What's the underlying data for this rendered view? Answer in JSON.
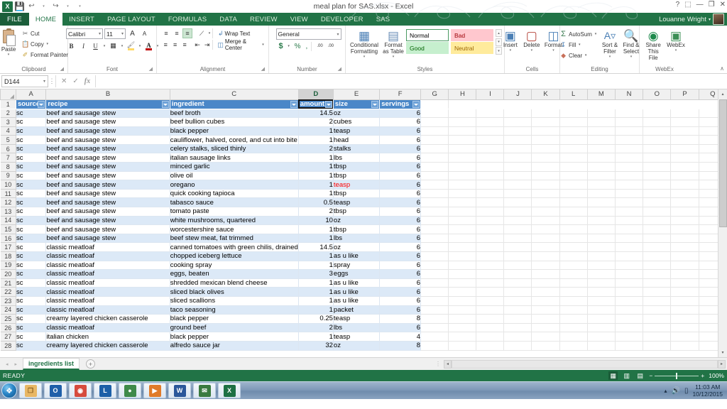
{
  "window": {
    "title": "meal plan for SAS.xlsx - Excel",
    "help_label": "?",
    "ribbon_display_label": "⬚",
    "minimize_label": "—",
    "restore_label": "❐",
    "close_label": "✕"
  },
  "quick_access": {
    "app_logo": "X",
    "items": [
      {
        "name": "save-icon",
        "glyph": "💾"
      },
      {
        "name": "undo-icon",
        "glyph": "↩"
      },
      {
        "name": "redo-icon",
        "glyph": "↪"
      },
      {
        "name": "customize-qat-icon",
        "glyph": "▾"
      }
    ]
  },
  "ribbon_tabs": {
    "file": "FILE",
    "items": [
      {
        "label": "HOME",
        "active": true
      },
      {
        "label": "INSERT",
        "active": false
      },
      {
        "label": "PAGE LAYOUT",
        "active": false
      },
      {
        "label": "FORMULAS",
        "active": false
      },
      {
        "label": "DATA",
        "active": false
      },
      {
        "label": "REVIEW",
        "active": false
      },
      {
        "label": "VIEW",
        "active": false
      },
      {
        "label": "DEVELOPER",
        "active": false
      },
      {
        "label": "SAS",
        "active": false
      }
    ]
  },
  "account": {
    "user_name": "Louanne Wright",
    "caret": "▾"
  },
  "ribbon": {
    "clipboard": {
      "group_label": "Clipboard",
      "paste_label": "Paste",
      "paste_caret": "▾",
      "cut_label": "Cut",
      "copy_label": "Copy",
      "copy_caret": "▾",
      "format_painter_label": "Format Painter",
      "dialog_launcher": "◢"
    },
    "font": {
      "group_label": "Font",
      "font_name": "Calibri",
      "font_size": "11",
      "grow_font": "A",
      "shrink_font": "A",
      "bold": "B",
      "italic": "I",
      "underline": "U",
      "borders_caret": "▾",
      "fill_color": "A",
      "font_color": "A",
      "fill_color_hex": "#ffd966",
      "font_color_hex": "#c00000",
      "dialog_launcher": "◢"
    },
    "alignment": {
      "group_label": "Alignment",
      "align_top": "≡",
      "align_middle": "≡",
      "align_bottom": "≡",
      "orientation": "⟋",
      "align_left": "≡",
      "align_center": "≡",
      "align_right": "≡",
      "decrease_indent": "⇤",
      "increase_indent": "⇥",
      "wrap_text_label": "Wrap Text",
      "merge_center_label": "Merge & Center",
      "merge_caret": "▾",
      "dialog_launcher": "◢"
    },
    "number": {
      "group_label": "Number",
      "format_value": "General",
      "format_caret": "▾",
      "currency": "$",
      "currency_caret": "▾",
      "percent": "%",
      "comma": ",",
      "increase_decimal": ".00",
      "decrease_decimal": ".00",
      "dialog_launcher": "◢"
    },
    "styles": {
      "group_label": "Styles",
      "conditional_formatting_label": "Conditional Formatting",
      "format_as_table_label": "Format as Table",
      "caret": "▾",
      "cells": [
        {
          "label": "Normal",
          "bg": "#ffffff",
          "fg": "#000000",
          "border": "#4a9a62"
        },
        {
          "label": "Bad",
          "bg": "#ffc7ce",
          "fg": "#9c0006",
          "border": "#ffc7ce"
        },
        {
          "label": "Good",
          "bg": "#c6efce",
          "fg": "#006100",
          "border": "#c6efce"
        },
        {
          "label": "Neutral",
          "bg": "#ffeb9c",
          "fg": "#9c6500",
          "border": "#ffeb9c"
        }
      ],
      "scroll_up": "▴",
      "scroll_down": "▾",
      "scroll_more": "▾"
    },
    "cells": {
      "group_label": "Cells",
      "insert_label": "Insert",
      "delete_label": "Delete",
      "format_label": "Format",
      "caret": "▾"
    },
    "editing": {
      "group_label": "Editing",
      "autosum_label": "AutoSum",
      "autosum_sigma": "Σ",
      "fill_label": "Fill",
      "clear_label": "Clear",
      "sort_filter_label": "Sort & Filter",
      "find_select_label": "Find & Select",
      "caret": "▾"
    },
    "webex": {
      "group_label": "WebEx",
      "share_this_file_label": "Share This File",
      "webex_label": "WebEx",
      "caret": "▾"
    },
    "collapse_ribbon": "∧"
  },
  "formula_bar": {
    "name_box_value": "D144",
    "name_box_caret": "▾",
    "insert_function_sep": "⋮",
    "cancel_icon": "✕",
    "enter_icon": "✓",
    "function_icon": "fx",
    "formula_value": ""
  },
  "grid": {
    "column_headers": [
      "A",
      "B",
      "C",
      "D",
      "E",
      "F",
      "G",
      "H",
      "I",
      "J",
      "K",
      "L",
      "M",
      "N",
      "O",
      "P",
      "Q"
    ],
    "highlighted_column": "D",
    "row_numbers": [
      1,
      2,
      3,
      4,
      5,
      6,
      7,
      8,
      9,
      10,
      11,
      12,
      13,
      14,
      15,
      16,
      17,
      18,
      19,
      20,
      21,
      22,
      23,
      24,
      25,
      26,
      27,
      28
    ],
    "table_headers": [
      "source",
      "recipe",
      "ingredient",
      "amount",
      "size",
      "servings"
    ],
    "filter_glyph": "▾",
    "sorted_column_index": 2,
    "rows": [
      {
        "row": 2,
        "source": "sc",
        "recipe": "beef and sausage stew",
        "ingredient": "beef broth",
        "amount": "14.5",
        "size": "oz",
        "servings": "6"
      },
      {
        "row": 3,
        "source": "sc",
        "recipe": "beef and sausage stew",
        "ingredient": "beef bullion cubes",
        "amount": "2",
        "size": "cubes",
        "servings": "6"
      },
      {
        "row": 4,
        "source": "sc",
        "recipe": "beef and sausage stew",
        "ingredient": "black pepper",
        "amount": "1",
        "size": "teasp",
        "servings": "6"
      },
      {
        "row": 5,
        "source": "sc",
        "recipe": "beef and sausage stew",
        "ingredient": "cauliflower, halved, cored, and cut into bite",
        "amount": "1",
        "size": "head",
        "servings": "6"
      },
      {
        "row": 6,
        "source": "sc",
        "recipe": "beef and sausage stew",
        "ingredient": "celery stalks, sliced thinly",
        "amount": "2",
        "size": "stalks",
        "servings": "6"
      },
      {
        "row": 7,
        "source": "sc",
        "recipe": "beef and sausage stew",
        "ingredient": "italian sausage links",
        "amount": "1",
        "size": "lbs",
        "servings": "6"
      },
      {
        "row": 8,
        "source": "sc",
        "recipe": "beef and sausage stew",
        "ingredient": "minced garlic",
        "amount": "1",
        "size": "tbsp",
        "servings": "6"
      },
      {
        "row": 9,
        "source": "sc",
        "recipe": "beef and sausage stew",
        "ingredient": "olive oil",
        "amount": "1",
        "size": "tbsp",
        "servings": "6"
      },
      {
        "row": 10,
        "source": "sc",
        "recipe": "beef and sausage stew",
        "ingredient": "oregano",
        "amount": "1",
        "size": "teasp",
        "servings": "6",
        "size_red": true
      },
      {
        "row": 11,
        "source": "sc",
        "recipe": "beef and sausage stew",
        "ingredient": "quick cooking tapioca",
        "amount": "1",
        "size": "tbsp",
        "servings": "6"
      },
      {
        "row": 12,
        "source": "sc",
        "recipe": "beef and sausage stew",
        "ingredient": "tabasco sauce",
        "amount": "0.5",
        "size": "teasp",
        "servings": "6"
      },
      {
        "row": 13,
        "source": "sc",
        "recipe": "beef and sausage stew",
        "ingredient": "tomato paste",
        "amount": "2",
        "size": "tbsp",
        "servings": "6"
      },
      {
        "row": 14,
        "source": "sc",
        "recipe": "beef and sausage stew",
        "ingredient": "white mushrooms, quartered",
        "amount": "10",
        "size": "oz",
        "servings": "6"
      },
      {
        "row": 15,
        "source": "sc",
        "recipe": "beef and sausage stew",
        "ingredient": "worcestershire sauce",
        "amount": "1",
        "size": "tbsp",
        "servings": "6"
      },
      {
        "row": 16,
        "source": "sc",
        "recipe": "beef and sausage stew",
        "ingredient": "beef stew meat, fat trimmed",
        "amount": "1",
        "size": "lbs",
        "servings": "6"
      },
      {
        "row": 17,
        "source": "sc",
        "recipe": "classic meatloaf",
        "ingredient": "canned tomatoes with green chilis, drained",
        "amount": "14.5",
        "size": "oz",
        "servings": "6"
      },
      {
        "row": 18,
        "source": "sc",
        "recipe": "classic meatloaf",
        "ingredient": "chopped iceberg lettuce",
        "amount": "1",
        "size": "as u like",
        "servings": "6"
      },
      {
        "row": 19,
        "source": "sc",
        "recipe": "classic meatloaf",
        "ingredient": "cooking spray",
        "amount": "1",
        "size": "spray",
        "servings": "6"
      },
      {
        "row": 20,
        "source": "sc",
        "recipe": "classic meatloaf",
        "ingredient": "eggs, beaten",
        "amount": "3",
        "size": "eggs",
        "servings": "6"
      },
      {
        "row": 21,
        "source": "sc",
        "recipe": "classic meatloaf",
        "ingredient": "shredded mexican blend cheese",
        "amount": "1",
        "size": "as u like",
        "servings": "6"
      },
      {
        "row": 22,
        "source": "sc",
        "recipe": "classic meatloaf",
        "ingredient": "sliced black olives",
        "amount": "1",
        "size": "as u like",
        "servings": "6"
      },
      {
        "row": 23,
        "source": "sc",
        "recipe": "classic meatloaf",
        "ingredient": "sliced scallions",
        "amount": "1",
        "size": "as u like",
        "servings": "6"
      },
      {
        "row": 24,
        "source": "sc",
        "recipe": "classic meatloaf",
        "ingredient": "taco seasoning",
        "amount": "1",
        "size": "packet",
        "servings": "6"
      },
      {
        "row": 25,
        "source": "sc",
        "recipe": "creamy layered chicken casserole",
        "ingredient": "black pepper",
        "amount": "0.25",
        "size": "teasp",
        "servings": "8"
      },
      {
        "row": 26,
        "source": "sc",
        "recipe": "classic meatloaf",
        "ingredient": "ground beef",
        "amount": "2",
        "size": "lbs",
        "servings": "6"
      },
      {
        "row": 27,
        "source": "sc",
        "recipe": "italian chicken",
        "ingredient": "black pepper",
        "amount": "1",
        "size": "teasp",
        "servings": "4"
      },
      {
        "row": 28,
        "source": "sc",
        "recipe": "creamy layered chicken casserole",
        "ingredient": "alfredo sauce jar",
        "amount": "32",
        "size": "oz",
        "servings": "8"
      }
    ],
    "scroll_up_arrow": "▴",
    "scroll_down_arrow": "▾"
  },
  "sheet_tabs": {
    "first_arrow": "◂",
    "last_arrow": "▸",
    "tabs": [
      {
        "label": "ingredients list",
        "active": true
      }
    ],
    "new_sheet_label": "+",
    "left_arrow": "◂",
    "right_arrow": "▸",
    "grip": "⋮"
  },
  "status_bar": {
    "mode": "READY",
    "views": [
      {
        "name": "normal-view-button",
        "glyph": "▦",
        "selected": true
      },
      {
        "name": "page-layout-view-button",
        "glyph": "▥",
        "selected": false
      },
      {
        "name": "page-break-preview-button",
        "glyph": "▤",
        "selected": false
      }
    ],
    "zoom_out": "−",
    "zoom_in": "+",
    "zoom_level": "100%"
  },
  "taskbar": {
    "start_glyph": "❖",
    "items": [
      {
        "name": "file-explorer-icon",
        "glyph": "❐",
        "bg": "#e8b765"
      },
      {
        "name": "outlook-icon",
        "glyph": "O",
        "bg": "#1f5fa9"
      },
      {
        "name": "chrome-icon",
        "glyph": "◉",
        "bg": "#d64b3d"
      },
      {
        "name": "lync-icon",
        "glyph": "L",
        "bg": "#1c5fa8"
      },
      {
        "name": "xbox-icon",
        "glyph": "●",
        "bg": "#3f8a4a"
      },
      {
        "name": "media-player-icon",
        "glyph": "▶",
        "bg": "#e07b2a"
      },
      {
        "name": "word-icon",
        "glyph": "W",
        "bg": "#2b579a"
      },
      {
        "name": "snagit-icon",
        "glyph": "✉",
        "bg": "#3a7a3f"
      },
      {
        "name": "excel-icon",
        "glyph": "X",
        "bg": "#1d7044"
      }
    ],
    "tray": {
      "show_hidden": "▴",
      "volume": "🔊",
      "battery": "▯",
      "time": "11:03 AM",
      "date": "10/12/2015"
    }
  }
}
